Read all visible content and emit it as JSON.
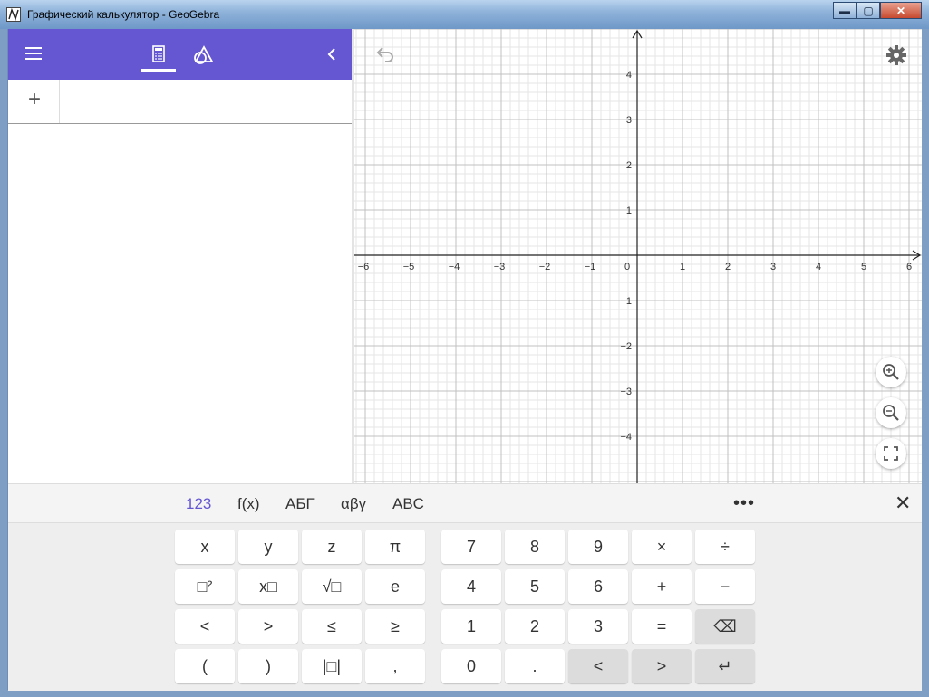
{
  "window": {
    "title": "Графический калькулятор - GeoGebra",
    "min_label": "▬",
    "max_label": "▢",
    "close_label": "✕"
  },
  "algebra": {
    "header_color": "#6557d2",
    "input_placeholder": ""
  },
  "graphics": {
    "x_ticks": [
      "−6",
      "−5",
      "−4",
      "−3",
      "−2",
      "−1",
      "0",
      "1",
      "2",
      "3",
      "4",
      "5",
      "6"
    ],
    "y_ticks": [
      "4",
      "3",
      "2",
      "1",
      "−1",
      "−2",
      "−3",
      "−4"
    ]
  },
  "keyboard": {
    "tabs": [
      "123",
      "f(x)",
      "АБГ",
      "αβγ",
      "ABC"
    ],
    "more": "•••",
    "close": "✕",
    "left_keys": [
      [
        "x",
        "y",
        "z",
        "π"
      ],
      [
        "□²",
        "x□",
        "√□",
        "e"
      ],
      [
        "<",
        ">",
        "≤",
        "≥"
      ],
      [
        "(",
        ")",
        "|□|",
        ","
      ]
    ],
    "right_keys": [
      [
        "7",
        "8",
        "9",
        "×",
        "÷"
      ],
      [
        "4",
        "5",
        "6",
        "+",
        "−"
      ],
      [
        "1",
        "2",
        "3",
        "=",
        "⌫"
      ],
      [
        "0",
        ".",
        "<",
        ">",
        "↵"
      ]
    ]
  },
  "colors": {
    "accent": "#6557d2",
    "grid_major": "#c0c0c0",
    "grid_minor": "#e6e6e6"
  }
}
